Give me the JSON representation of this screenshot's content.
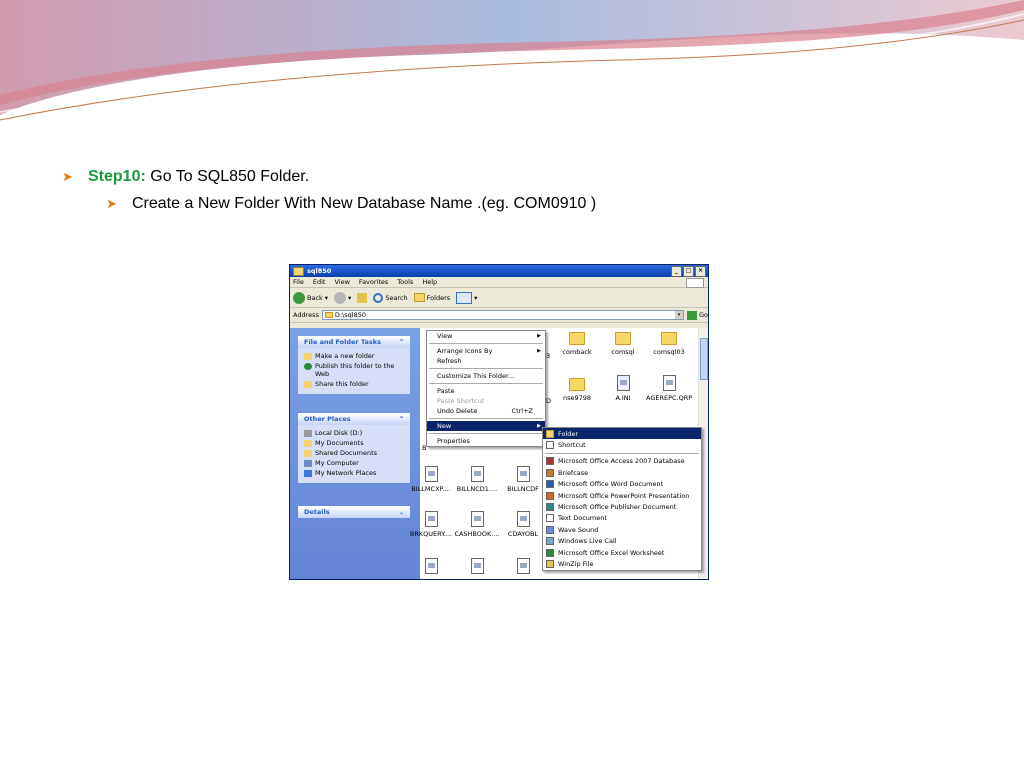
{
  "slide": {
    "step_label": "Step10:",
    "step_text": " Go To SQL850 Folder.",
    "sub_text": "Create a New Folder With New Database Name .(eg. COM0910 )",
    "colors": {
      "step": "#1a9a3a",
      "bullet": "#e07b19"
    }
  },
  "window": {
    "title": "sql850",
    "menu": [
      "File",
      "Edit",
      "View",
      "Favorites",
      "Tools",
      "Help"
    ],
    "toolbar": {
      "back": "Back",
      "search": "Search",
      "folders": "Folders"
    },
    "address_label": "Address",
    "address_value": "D:\\sql850",
    "go": "Go",
    "tasks": {
      "title": "File and Folder Tasks",
      "items": [
        "Make a new folder",
        "Publish this folder to the Web",
        "Share this folder"
      ]
    },
    "other_places": {
      "title": "Other Places",
      "items": [
        "Local Disk (D:)",
        "My Documents",
        "Shared Documents",
        "My Computer",
        "My Network Places"
      ]
    },
    "details": {
      "title": "Details"
    },
    "files": [
      {
        "name": "comback",
        "kind": "folder"
      },
      {
        "name": "comsql",
        "kind": "folder"
      },
      {
        "name": "comsql03",
        "kind": "folder"
      },
      {
        "name": "nse9798",
        "kind": "folder"
      },
      {
        "name": "A.INI",
        "kind": "ini"
      },
      {
        "name": "AGEREPC.QRP",
        "kind": "doc"
      },
      {
        "name": "BILLMCXP....",
        "kind": "doc"
      },
      {
        "name": "BILLNCD1....",
        "kind": "doc"
      },
      {
        "name": "BILLNCDF",
        "kind": "doc"
      },
      {
        "name": "BRKQUERY....",
        "kind": "doc"
      },
      {
        "name": "CASHBOOK....",
        "kind": "doc"
      },
      {
        "name": "CDAYOBL",
        "kind": "doc"
      }
    ],
    "partial_labels": {
      "a": "3",
      "b": "D",
      "c": "B"
    }
  },
  "context_menu": {
    "items": [
      {
        "label": "View",
        "submenu": true
      },
      {
        "label": "Arrange Icons By",
        "submenu": true
      },
      {
        "label": "Refresh"
      },
      {
        "label": "Customize This Folder..."
      },
      {
        "label": "Paste"
      },
      {
        "label": "Paste Shortcut",
        "disabled": true
      },
      {
        "label": "Undo Delete",
        "shortcut": "Ctrl+Z"
      },
      {
        "label": "New",
        "submenu": true,
        "highlighted": true
      },
      {
        "label": "Properties"
      }
    ]
  },
  "new_submenu": {
    "items": [
      {
        "label": "Folder",
        "highlighted": true
      },
      {
        "label": "Shortcut"
      },
      {
        "label": "Microsoft Office Access 2007 Database"
      },
      {
        "label": "Briefcase"
      },
      {
        "label": "Microsoft Office Word Document"
      },
      {
        "label": "Microsoft Office PowerPoint Presentation"
      },
      {
        "label": "Microsoft Office Publisher Document"
      },
      {
        "label": "Text Document"
      },
      {
        "label": "Wave Sound"
      },
      {
        "label": "Windows Live Call"
      },
      {
        "label": "Microsoft Office Excel Worksheet"
      },
      {
        "label": "WinZip File"
      }
    ]
  }
}
